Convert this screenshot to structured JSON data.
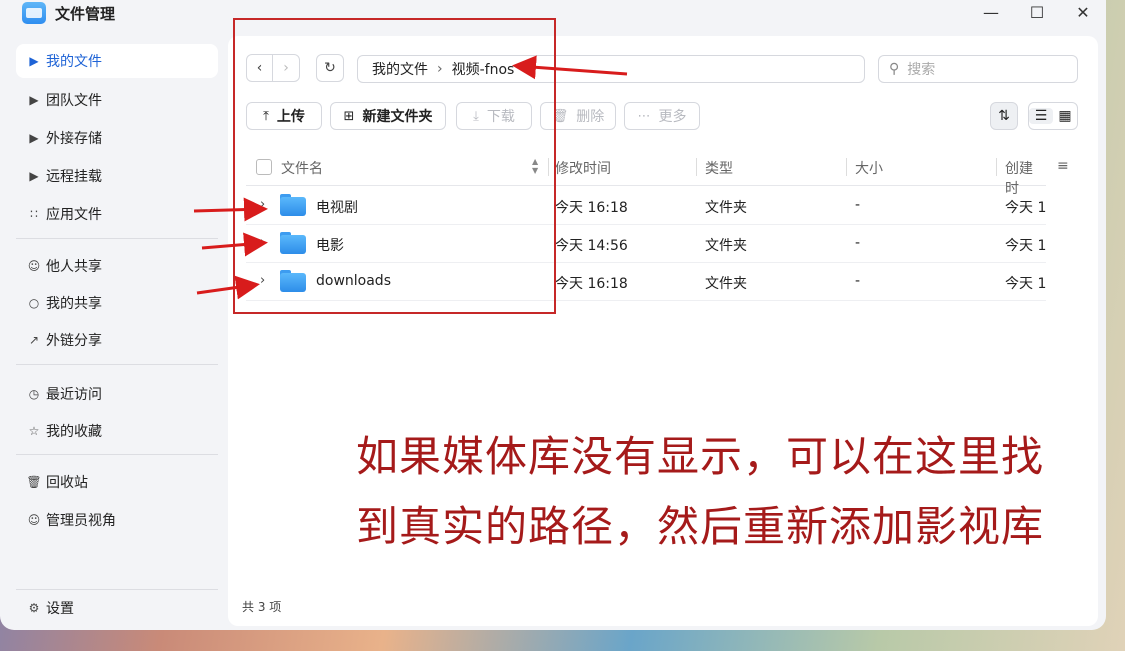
{
  "window": {
    "title": "文件管理",
    "controls": [
      "minimize",
      "maximize",
      "close"
    ]
  },
  "sidebar": {
    "items": [
      {
        "label": "我的文件",
        "icon": "caret-right-icon",
        "active": true
      },
      {
        "label": "团队文件",
        "icon": "caret-right-icon"
      },
      {
        "label": "外接存储",
        "icon": "caret-right-icon"
      },
      {
        "label": "远程挂载",
        "icon": "caret-right-icon"
      },
      {
        "label": "应用文件",
        "icon": "grid-icon"
      },
      {
        "label": "他人共享",
        "icon": "user-icon"
      },
      {
        "label": "我的共享",
        "icon": "share-icon"
      },
      {
        "label": "外链分享",
        "icon": "external-link-icon"
      },
      {
        "label": "最近访问",
        "icon": "clock-icon"
      },
      {
        "label": "我的收藏",
        "icon": "star-icon"
      },
      {
        "label": "回收站",
        "icon": "trash-icon"
      },
      {
        "label": "管理员视角",
        "icon": "admin-user-icon"
      }
    ],
    "settings_label": "设置"
  },
  "breadcrumb": [
    "我的文件",
    "视频-fnos"
  ],
  "search": {
    "placeholder": "搜索"
  },
  "toolbar": {
    "upload": "上传",
    "new_folder": "新建文件夹",
    "download": "下载",
    "delete": "删除",
    "more": "更多"
  },
  "table": {
    "headers": {
      "name": "文件名",
      "modified": "修改时间",
      "type": "类型",
      "size": "大小",
      "created": "创建时"
    },
    "rows": [
      {
        "name": "电视剧",
        "modified": "今天 16:18",
        "type": "文件夹",
        "size": "-",
        "created": "今天 1"
      },
      {
        "name": "电影",
        "modified": "今天 14:56",
        "type": "文件夹",
        "size": "-",
        "created": "今天 1"
      },
      {
        "name": "downloads",
        "modified": "今天 16:18",
        "type": "文件夹",
        "size": "-",
        "created": "今天 1"
      }
    ]
  },
  "footer": {
    "count": "共 3 项"
  },
  "annotation": {
    "text": "如果媒体库没有显示，可以在这里找到真实的路径，然后重新添加影视库",
    "color": "#a51a1a"
  },
  "colors": {
    "accent": "#1e63d6",
    "folder": "#3d9cf0",
    "annotation_red": "#c62828"
  }
}
